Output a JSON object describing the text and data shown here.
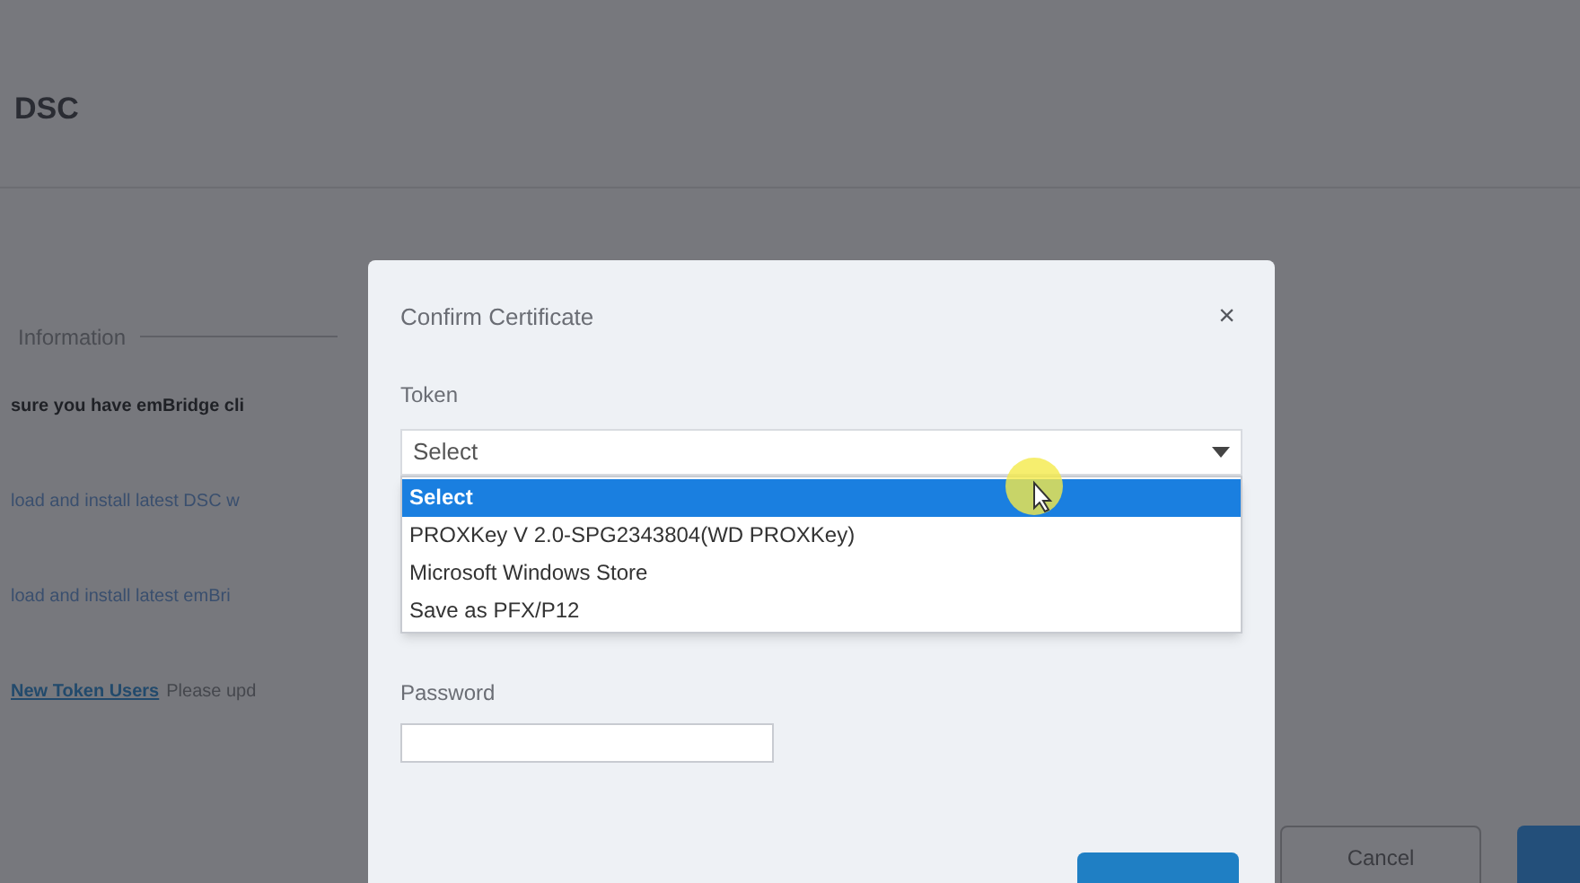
{
  "page": {
    "heading": "DSC",
    "section_title": "Information",
    "lines": [
      {
        "kind": "bold",
        "text": "sure you have emBridge cli"
      },
      {
        "kind": "link",
        "text": "load and install latest DSC w"
      },
      {
        "kind": "link",
        "text": "load and install latest emBri"
      },
      {
        "kind": "mixed",
        "link": "New Token Users",
        "text": "Please upd"
      }
    ],
    "buttons": [
      {
        "kind": "outline",
        "label": "Cancel"
      },
      {
        "kind": "primary"
      }
    ]
  },
  "dialog": {
    "title": "Confirm Certificate",
    "close": "×",
    "token_label": "Token",
    "token_value": "Select",
    "options": [
      {
        "label": "Select",
        "selected": true
      },
      {
        "label": "PROXKey V 2.0-SPG2343804(WD PROXKey)",
        "selected": false
      },
      {
        "label": "Microsoft Windows Store",
        "selected": false
      },
      {
        "label": "Save as PFX/P12",
        "selected": false
      }
    ],
    "password_label": "Password"
  }
}
